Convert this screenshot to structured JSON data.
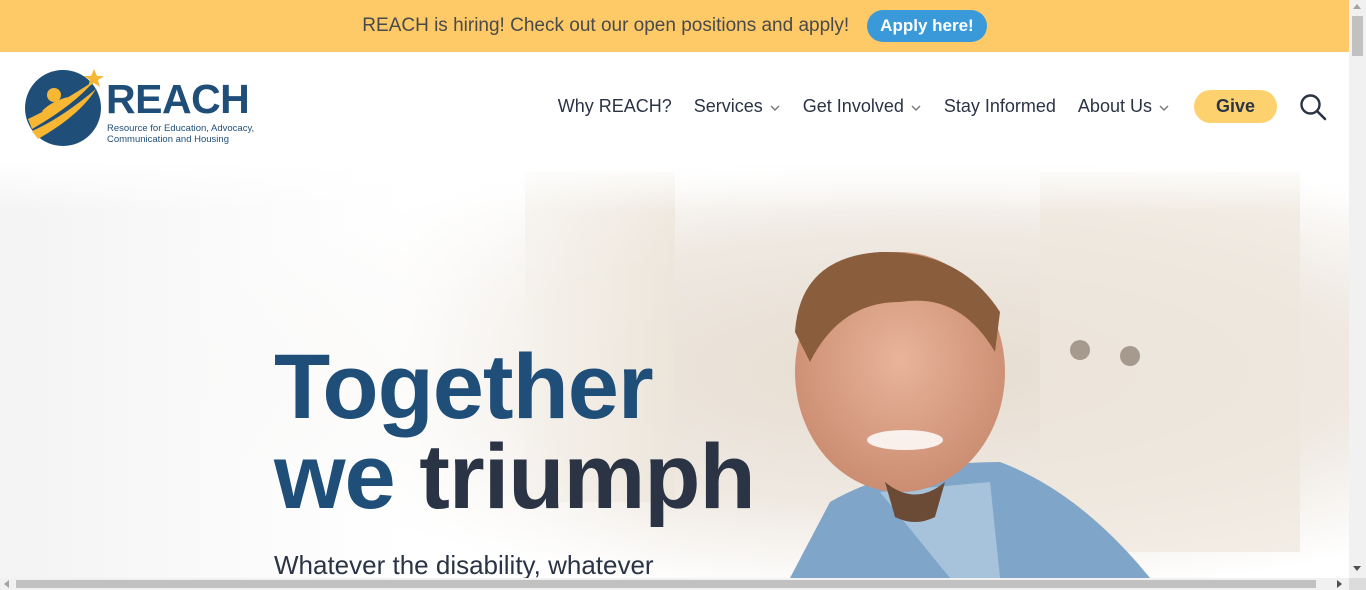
{
  "banner": {
    "text": "REACH is hiring! Check out our open positions and apply!",
    "button_label": "Apply here!"
  },
  "logo": {
    "wordmark": "REACH",
    "tagline_lines": [
      "Resource for Education, Advocacy,",
      "Communication and Housing"
    ],
    "icon": "star-figure-icon"
  },
  "nav": {
    "items": [
      {
        "label": "Why REACH?",
        "has_dropdown": false
      },
      {
        "label": "Services",
        "has_dropdown": true
      },
      {
        "label": "Get Involved",
        "has_dropdown": true
      },
      {
        "label": "Stay Informed",
        "has_dropdown": false
      },
      {
        "label": "About Us",
        "has_dropdown": true
      }
    ],
    "give_label": "Give",
    "search_icon": "search-icon"
  },
  "hero": {
    "title_line1": "Together",
    "title_line2a": "we",
    "title_line2b": "triumph",
    "subtitle": "Whatever the disability, whatever"
  },
  "colors": {
    "banner_bg": "#fdca67",
    "apply_button": "#3a9ad9",
    "brand_navy": "#1f4e79",
    "brand_yellow": "#f7b733",
    "give_button": "#fdd26e",
    "text_dark": "#2b3445"
  }
}
